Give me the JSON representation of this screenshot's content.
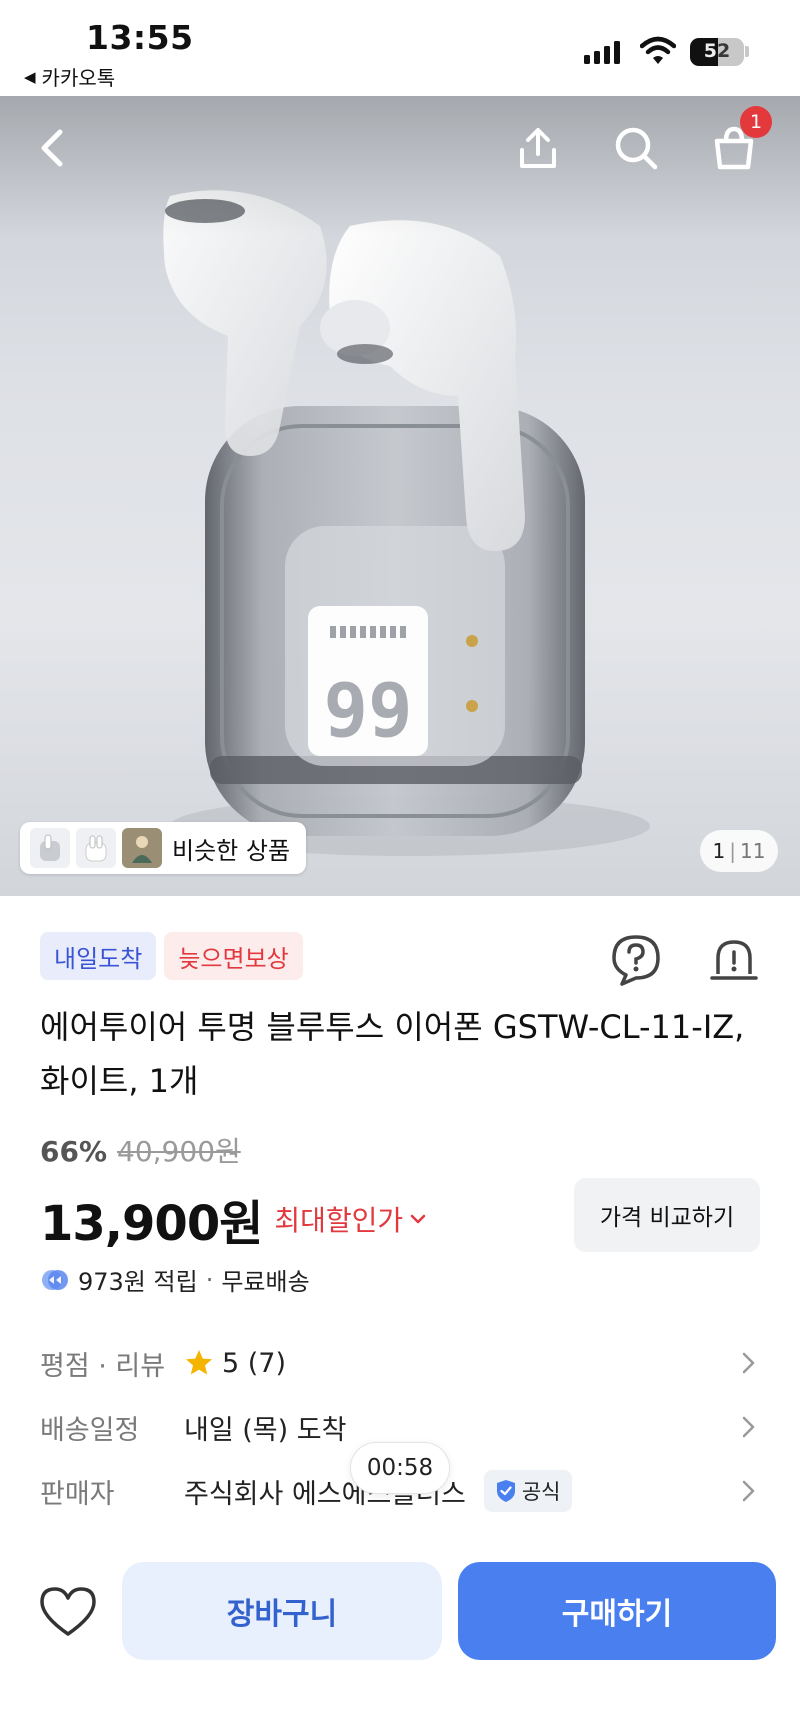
{
  "status_bar": {
    "time": "13:55",
    "back_app": "카카오톡",
    "battery": "52",
    "battery_level": 0.52,
    "signal_bars": 4
  },
  "hero": {
    "similar_products_label": "비슷한 상품",
    "image_index": "1",
    "image_total": "11",
    "cart_count": "1",
    "case_display_number": "99"
  },
  "product": {
    "badges": [
      "내일도착",
      "늦으면보상"
    ],
    "title": "에어투이어 투명 블루투스 이어폰 GSTW-CL-11-IZ, 화이트, 1개",
    "discount_percent": "66%",
    "original_price": "40,900원",
    "price": "13,900원",
    "max_discount_label": "최대할인가",
    "compare_button": "가격 비교하기",
    "points": "973원 적립",
    "shipping": "무료배송"
  },
  "info_rows": {
    "rating": {
      "label": "평점 · 리뷰",
      "value": "5 (7)"
    },
    "delivery": {
      "label": "배송일정",
      "value": "내일 (목) 도착"
    },
    "seller": {
      "label": "판매자",
      "value": "주식회사 에스에스플러스",
      "official": "공식"
    }
  },
  "timer": "00:58",
  "bottom_bar": {
    "cart_button": "장바구니",
    "buy_button": "구매하기"
  },
  "colors": {
    "accent_blue": "#4a7ff0",
    "discount_red": "#e2393f",
    "badge_blue": "#3a54d6",
    "star": "#f5b400"
  }
}
